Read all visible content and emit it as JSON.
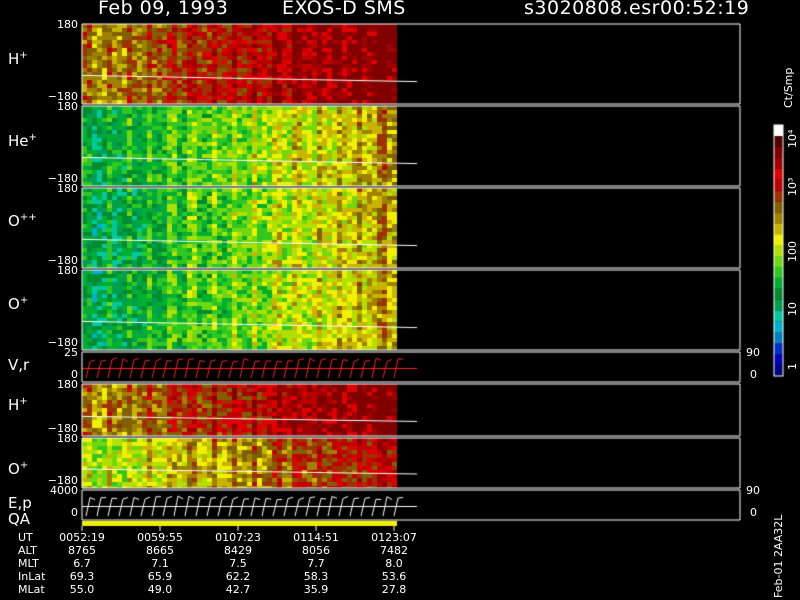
{
  "header": {
    "date": "Feb 09, 1993",
    "instrument": "EXOS-D SMS",
    "file": "s3020808.esr",
    "time": "00:52:19"
  },
  "panels": [
    {
      "id": "h",
      "label": "H",
      "sup": "+",
      "top_tick": "180",
      "bottom_tick": "−180"
    },
    {
      "id": "he",
      "label": "He",
      "sup": "+",
      "top_tick": "180",
      "bottom_tick": "−180"
    },
    {
      "id": "opp",
      "label": "O",
      "sup": "++",
      "top_tick": "180",
      "bottom_tick": "−180"
    },
    {
      "id": "o",
      "label": "O",
      "sup": "+",
      "top_tick": "180",
      "bottom_tick": "−180"
    },
    {
      "id": "vr",
      "label": "V,r",
      "sup": "",
      "top_tick": "25",
      "bottom_tick": "0",
      "right_top": "90",
      "right_bottom": "0"
    },
    {
      "id": "h2",
      "label": "H",
      "sup": "+",
      "top_tick": "180",
      "bottom_tick": "−180"
    },
    {
      "id": "o2",
      "label": "O",
      "sup": "+",
      "top_tick": "180",
      "bottom_tick": "−180"
    },
    {
      "id": "ep",
      "label": "E,p",
      "sup": "",
      "top_tick": "4000",
      "bottom_tick": "0",
      "right_top": "90",
      "right_bottom": "0"
    }
  ],
  "qa_label": "QA",
  "colorbar": {
    "unit": "Ct/Smp",
    "ticks": [
      "10⁴",
      "10³",
      "100",
      "10",
      "1"
    ],
    "colors": [
      "#000080",
      "#0000b4",
      "#0030c8",
      "#0080c0",
      "#00b0d0",
      "#00c8a0",
      "#00a050",
      "#008c30",
      "#00b030",
      "#30c820",
      "#70d810",
      "#b0e000",
      "#f0f000",
      "#c8b400",
      "#a08000",
      "#806000",
      "#a03000",
      "#c00000",
      "#e00000",
      "#a00000",
      "#800000",
      "#500000",
      "#ffffff"
    ]
  },
  "footer_code": "Feb-01 2AA32L",
  "ephemeris": {
    "labels": [
      "UT",
      "ALT",
      "MLT",
      "InLat",
      "MLat"
    ],
    "columns": [
      [
        "0052:19",
        "8765",
        "6.7",
        "69.3",
        "55.0"
      ],
      [
        "0059:55",
        "8665",
        "7.1",
        "65.9",
        "49.0"
      ],
      [
        "0107:23",
        "8429",
        "7.5",
        "62.2",
        "42.7"
      ],
      [
        "0114:51",
        "8056",
        "7.7",
        "58.3",
        "35.9"
      ],
      [
        "0123:07",
        "7482",
        "8.0",
        "53.6",
        "27.8"
      ]
    ]
  },
  "chart_data": {
    "type": "heatmap",
    "title": "Feb 09, 1993   EXOS-D SMS",
    "x": [
      "0052:19",
      "0059:55",
      "0107:23",
      "0114:51",
      "0123:07"
    ],
    "ylim": [
      -180,
      180
    ],
    "colorbar_unit": "Ct/Smp",
    "colorbar_range": [
      1,
      10000
    ],
    "colorbar_scale": "log",
    "panels": [
      "H+",
      "He+",
      "O++",
      "O+",
      "V,r",
      "H+",
      "O+",
      "E,p"
    ]
  }
}
